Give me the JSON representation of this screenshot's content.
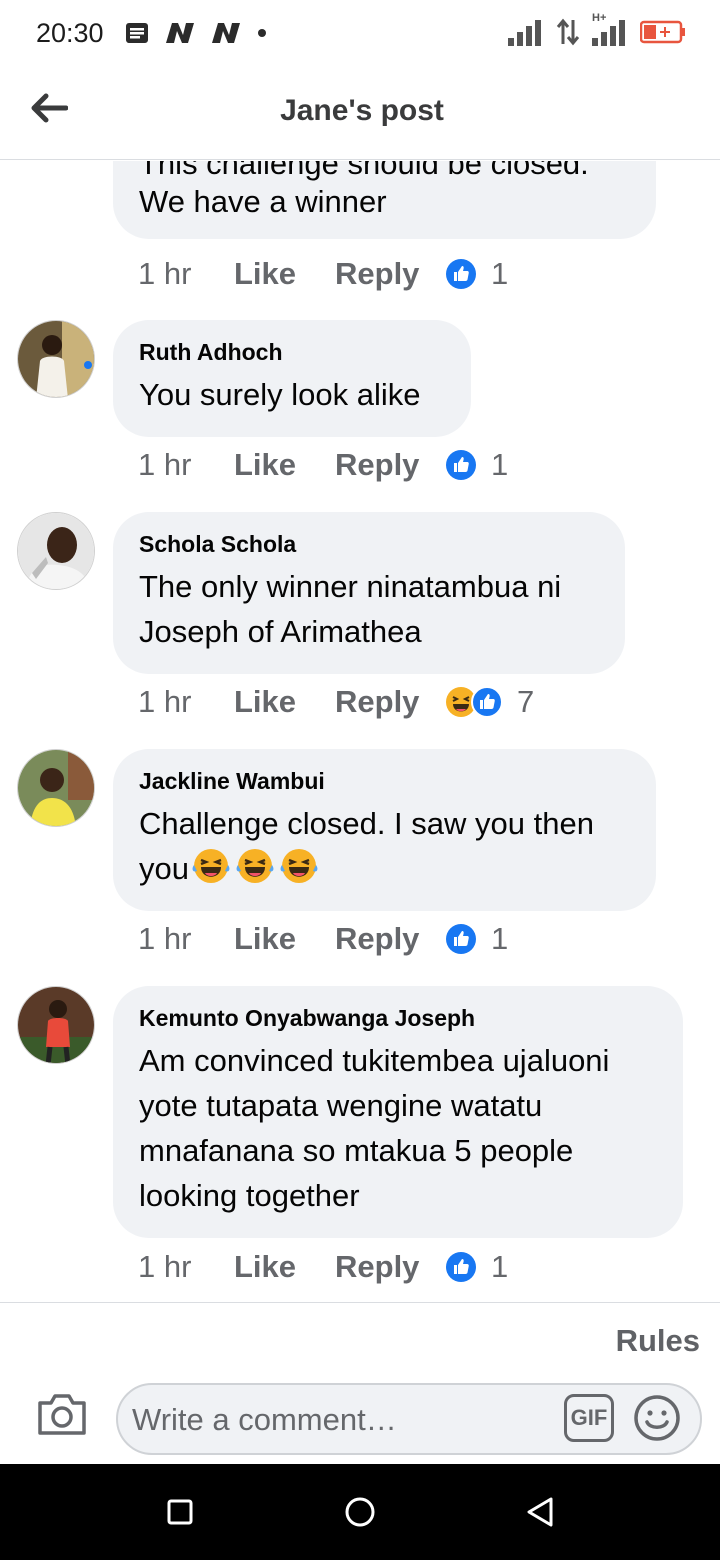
{
  "status_bar": {
    "time": "20:30",
    "left_icons": [
      "notes-icon",
      "n-app-icon",
      "n-app-icon",
      "dot-icon"
    ],
    "network_label": "H+"
  },
  "header": {
    "title": "Jane's post",
    "back_icon": "arrow-left-icon"
  },
  "previous_comment": {
    "clipped_text": "This challenge should be closed.",
    "text": "We have a winner",
    "time": "1 hr",
    "like_label": "Like",
    "reply_label": "Reply",
    "reaction_count": "1"
  },
  "comments": [
    {
      "author": "Ruth Adhoch",
      "text": "You surely look alike",
      "time": "1 hr",
      "like_label": "Like",
      "reply_label": "Reply",
      "reactions": [
        "like"
      ],
      "reaction_count": "1"
    },
    {
      "author": "Schola Schola",
      "text": "The only winner ninatambua ni\nJoseph of Arimathea",
      "time": "1 hr",
      "like_label": "Like",
      "reply_label": "Reply",
      "reactions": [
        "haha",
        "like"
      ],
      "reaction_count": "7"
    },
    {
      "author": "Jackline Wambui",
      "text": "Challenge closed. I saw you then\nyou",
      "emojis": [
        "😂",
        "😂",
        "😂"
      ],
      "time": "1 hr",
      "like_label": "Like",
      "reply_label": "Reply",
      "reactions": [
        "like"
      ],
      "reaction_count": "1"
    },
    {
      "author": "Kemunto Onyabwanga Joseph",
      "text": "Am convinced tukitembea ujaluoni\nyote tutapata wengine watatu\nmnafanana so mtakua 5 people\nlooking together",
      "time": "1 hr",
      "like_label": "Like",
      "reply_label": "Reply",
      "reactions": [
        "like"
      ],
      "reaction_count": "1"
    }
  ],
  "footer": {
    "rules_label": "Rules",
    "input_placeholder": "Write a comment…",
    "gif_label": "GIF",
    "camera_icon": "camera-icon",
    "emoji_icon": "smiley-icon"
  },
  "colors": {
    "bubble": "#f0f2f5",
    "like_blue": "#1877f2",
    "secondary_text": "#65676b"
  }
}
